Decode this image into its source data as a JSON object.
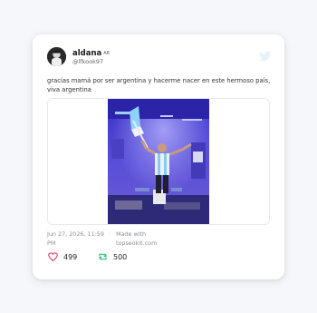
{
  "tweet": {
    "display_name": "aldana",
    "flag_code": "AR",
    "handle": "@lfkook97",
    "text": "gracias mamá por ser argentina y hacerme nacer en este hermoso país, viva argentina",
    "date": "Jun 27, 2026, 11:59 PM",
    "separator": "·",
    "made_with": "Made with topseokit.com",
    "likes": "499",
    "retweets": "500"
  },
  "icons": {
    "brand": "twitter-bird-icon",
    "like": "heart-icon",
    "retweet": "retweet-icon"
  },
  "colors": {
    "like": "#e0245e",
    "retweet": "#17bf63",
    "twitter_brand": "#e8f2fb",
    "background": "#f6f7fa"
  }
}
